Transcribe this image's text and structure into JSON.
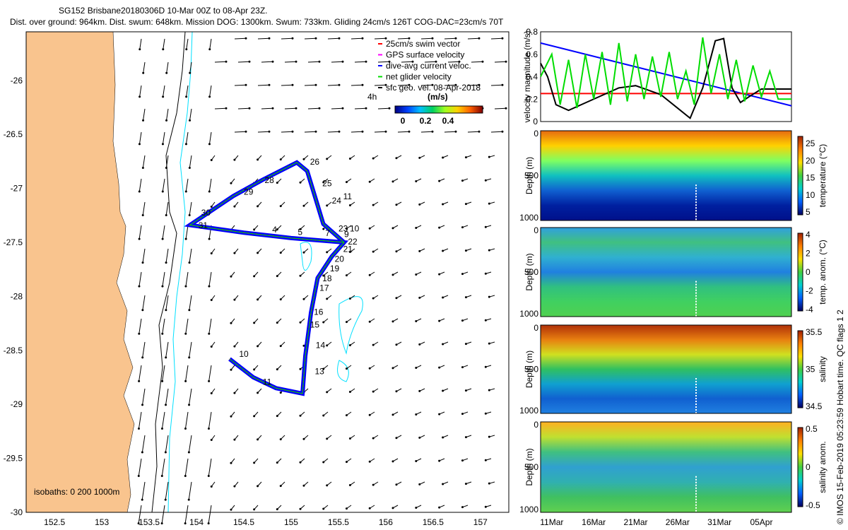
{
  "title": {
    "line1": "SG152 Brisbane20180306D 10-Mar 00Z to 08-Apr 23Z.",
    "line2": "Dist. over ground: 964km. Dist. swum: 648km. Mission DOG: 1300km. Swum: 733km. Gliding 24cm/s 126T COG-DAC=23cm/s 70T"
  },
  "footer": "© IMOS 15-Feb-2019 05:23:59 Hobart time. QC flags 1  2",
  "chart_data": [
    {
      "type": "map",
      "xlim": [
        152.2,
        157.3
      ],
      "ylim": [
        -30.0,
        -25.55
      ],
      "xticks": [
        "152.5",
        "153",
        "153.5",
        "154",
        "154.5",
        "155",
        "155.5",
        "156",
        "156.5",
        "157"
      ],
      "xtick_values": [
        152.5,
        153,
        153.5,
        154,
        154.5,
        155,
        155.5,
        156,
        156.5,
        157
      ],
      "yticks": [
        "-26",
        "-26.5",
        "-27",
        "-27.5",
        "-28",
        "-28.5",
        "-29",
        "-29.5",
        "-30"
      ],
      "ytick_values": [
        -26,
        -26.5,
        -27,
        -27.5,
        -28,
        -28.5,
        -29,
        -29.5,
        -30
      ],
      "land_color": "#f9c48e",
      "legend": [
        {
          "label": "25cm/s swim vector",
          "color": "#ff0000"
        },
        {
          "label": "GPS surface velocity",
          "color": "#ff00ff"
        },
        {
          "label": "dive-avg current veloc.",
          "color": "#0000ff"
        },
        {
          "label": "net glider velocity",
          "color": "#00dd00"
        },
        {
          "label": "sfc geo. vel. 08-Apr-2018",
          "color": "#000000"
        }
      ],
      "legend_placement": "top-right",
      "scale_label": "4h",
      "colorbar": {
        "label": "(m/s)",
        "ticks": [
          "0",
          "0.2",
          "0.4"
        ]
      },
      "isobaths_label": "isobaths: 0   200  1000m",
      "track": [
        [
          154.35,
          -28.58
        ],
        [
          154.6,
          -28.75
        ],
        [
          154.84,
          -28.85
        ],
        [
          155.12,
          -28.9
        ],
        [
          155.15,
          -28.55
        ],
        [
          155.21,
          -28.15
        ],
        [
          155.28,
          -27.83
        ],
        [
          155.43,
          -27.63
        ],
        [
          155.56,
          -27.5
        ],
        [
          155.0,
          -27.46
        ],
        [
          154.5,
          -27.41
        ],
        [
          153.93,
          -27.34
        ],
        [
          154.39,
          -27.07
        ],
        [
          154.7,
          -26.92
        ],
        [
          155.06,
          -26.76
        ],
        [
          155.17,
          -26.84
        ],
        [
          155.34,
          -27.33
        ],
        [
          155.56,
          -27.5
        ]
      ],
      "day_labels": [
        {
          "t": "10",
          "lon": 154.45,
          "lat": -28.56
        },
        {
          "t": "11",
          "lon": 154.7,
          "lat": -28.82
        },
        {
          "t": "13",
          "lon": 155.25,
          "lat": -28.72
        },
        {
          "t": "14",
          "lon": 155.26,
          "lat": -28.48
        },
        {
          "t": "15",
          "lon": 155.2,
          "lat": -28.29
        },
        {
          "t": "16",
          "lon": 155.24,
          "lat": -28.17
        },
        {
          "t": "17",
          "lon": 155.3,
          "lat": -27.95
        },
        {
          "t": "18",
          "lon": 155.33,
          "lat": -27.86
        },
        {
          "t": "19",
          "lon": 155.41,
          "lat": -27.77
        },
        {
          "t": "20",
          "lon": 155.46,
          "lat": -27.68
        },
        {
          "t": "21",
          "lon": 155.55,
          "lat": -27.59
        },
        {
          "t": "22",
          "lon": 155.6,
          "lat": -27.52
        },
        {
          "t": "9",
          "lon": 155.56,
          "lat": -27.45
        },
        {
          "t": "23",
          "lon": 155.5,
          "lat": -27.4
        },
        {
          "t": "10",
          "lon": 155.62,
          "lat": -27.4
        },
        {
          "t": "24",
          "lon": 155.43,
          "lat": -27.14
        },
        {
          "t": "25",
          "lon": 155.33,
          "lat": -26.98
        },
        {
          "t": "11",
          "lon": 155.55,
          "lat": -27.1
        },
        {
          "t": "26",
          "lon": 155.2,
          "lat": -26.78
        },
        {
          "t": "28",
          "lon": 154.72,
          "lat": -26.95
        },
        {
          "t": "29",
          "lon": 154.5,
          "lat": -27.06
        },
        {
          "t": "30",
          "lon": 154.05,
          "lat": -27.25
        },
        {
          "t": "31",
          "lon": 154.02,
          "lat": -27.37
        },
        {
          "t": "5",
          "lon": 155.07,
          "lat": -27.43
        },
        {
          "t": "7",
          "lon": 155.36,
          "lat": -27.44
        },
        {
          "t": "4",
          "lon": 154.8,
          "lat": -27.41
        }
      ]
    },
    {
      "type": "line",
      "ylabel": "velocity magnitude (m/s)",
      "ylim": [
        0,
        0.8
      ],
      "yticks": [
        "0",
        "0.2",
        "0.4",
        "0.6",
        "0.8"
      ],
      "xlim": [
        "2018-03-09T16:00",
        "2018-04-08T14:00"
      ],
      "series": [
        {
          "color": "#0000ff",
          "x": [
            "2018-03-09T16:00",
            "2018-04-08T14:00"
          ],
          "values": [
            0.7,
            0.14
          ]
        },
        {
          "color": "#ff0000",
          "x": [
            "2018-03-09T16:00",
            "2018-04-08T14:00"
          ],
          "values": [
            0.25,
            0.25
          ]
        },
        {
          "color": "#000000",
          "x": [
            "2018-03-09T16:00",
            "2018-03-10T12:00",
            "2018-03-11T12:00",
            "2018-03-13T00:00",
            "2018-03-16T00:00",
            "2018-03-19T00:00",
            "2018-03-21T00:00",
            "2018-03-24T00:00",
            "2018-03-26T00:00",
            "2018-03-27T12:00",
            "2018-03-29T00:00",
            "2018-03-30T12:00",
            "2018-03-31T12:00",
            "2018-04-01T12:00",
            "2018-04-02T12:00",
            "2018-04-03T12:00",
            "2018-04-05T00:00",
            "2018-04-08T14:00"
          ],
          "values": [
            0.52,
            0.4,
            0.15,
            0.1,
            0.2,
            0.3,
            0.32,
            0.24,
            0.12,
            0.03,
            0.3,
            0.72,
            0.74,
            0.3,
            0.17,
            0.22,
            0.29,
            0.29
          ]
        },
        {
          "color": "#00dd00",
          "x": [
            "2018-03-09T16:00",
            "2018-03-11T00:00",
            "2018-03-12T00:00",
            "2018-03-13T00:00",
            "2018-03-14T00:00",
            "2018-03-15T00:00",
            "2018-03-16T00:00",
            "2018-03-17T00:00",
            "2018-03-18T00:00",
            "2018-03-19T00:00",
            "2018-03-20T00:00",
            "2018-03-21T00:00",
            "2018-03-22T00:00",
            "2018-03-23T00:00",
            "2018-03-24T00:00",
            "2018-03-25T00:00",
            "2018-03-26T00:00",
            "2018-03-27T00:00",
            "2018-03-28T00:00",
            "2018-03-29T00:00",
            "2018-03-30T00:00",
            "2018-03-31T00:00",
            "2018-04-01T00:00",
            "2018-04-02T00:00",
            "2018-04-03T00:00",
            "2018-04-04T00:00",
            "2018-04-05T00:00",
            "2018-04-06T00:00",
            "2018-04-07T00:00",
            "2018-04-08T14:00"
          ],
          "values": [
            0.4,
            0.6,
            0.15,
            0.55,
            0.12,
            0.6,
            0.2,
            0.62,
            0.15,
            0.7,
            0.18,
            0.6,
            0.2,
            0.58,
            0.22,
            0.62,
            0.2,
            0.45,
            0.15,
            0.75,
            0.25,
            0.6,
            0.2,
            0.55,
            0.18,
            0.5,
            0.22,
            0.45,
            0.2,
            0.2
          ]
        }
      ]
    },
    {
      "type": "heatmap",
      "ylabel": "Depth (m)",
      "yticks": [
        "0",
        "500",
        "1000"
      ],
      "colorbar_label": "temperature (°C)",
      "colorbar_ticks": [
        "5",
        "10",
        "15",
        "20",
        "25"
      ],
      "profile": [
        "#e66a10",
        "#ffd000",
        "#80ff60",
        "#10c0c0",
        "#1060d0",
        "#0020a0",
        "#00108a"
      ]
    },
    {
      "type": "heatmap",
      "ylabel": "Depth (m)",
      "yticks": [
        "0",
        "500",
        "1000"
      ],
      "colorbar_label": "temp. anom. (°C)",
      "colorbar_ticks": [
        "4",
        "2",
        "0",
        "-2",
        "-4"
      ],
      "profile": [
        "#30a0e0",
        "#40c080",
        "#30b0d0",
        "#2080e0",
        "#30c080",
        "#40d060",
        "#50d050"
      ]
    },
    {
      "type": "heatmap",
      "ylabel": "Depth (m)",
      "yticks": [
        "0",
        "500",
        "1000"
      ],
      "colorbar_label": "salinity",
      "colorbar_ticks": [
        "35.5",
        "35",
        "34.5"
      ],
      "profile": [
        "#b03008",
        "#e88010",
        "#d0e020",
        "#30c060",
        "#10a0d0",
        "#1060d0",
        "#2080e0"
      ]
    },
    {
      "type": "heatmap",
      "ylabel": "Depth (m)",
      "yticks": [
        "0",
        "500",
        "1000"
      ],
      "colorbar_label": "salinity anom.",
      "colorbar_ticks": [
        "0.5",
        "0",
        "-0.5"
      ],
      "profile": [
        "#ffb020",
        "#c0e030",
        "#40c080",
        "#30a0d0",
        "#30b0b0",
        "#40c060",
        "#60d050"
      ],
      "xticks": [
        "11Mar",
        "16Mar",
        "21Mar",
        "26Mar",
        "31Mar",
        "05Apr"
      ],
      "xtick_dates": [
        "2018-03-11",
        "2018-03-16",
        "2018-03-21",
        "2018-03-26",
        "2018-03-31",
        "2018-04-05"
      ]
    }
  ]
}
